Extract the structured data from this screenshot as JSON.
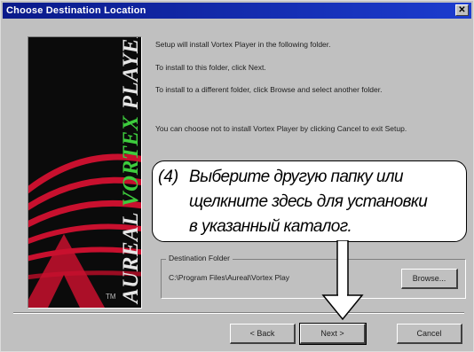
{
  "window": {
    "title": "Choose Destination Location",
    "close_glyph": "✕"
  },
  "banner": {
    "brand_word1": "AUREAL ",
    "brand_word2": "VORTEX",
    "brand_word3": " PLAYER",
    "tm": "TM",
    "colors": {
      "accent_green": "#3dcc3d",
      "accent_red": "#c8102e"
    }
  },
  "content": {
    "paragraphs": [
      "Setup will install Vortex Player in the following folder.",
      "To install to this folder, click Next.",
      "To install to a different folder, click Browse and select another folder.",
      "You can choose not to install Vortex Player by clicking Cancel to exit Setup."
    ]
  },
  "callout": {
    "number": "(4)",
    "lines": [
      "Выберите другую папку или",
      "щелкните здесь для установки",
      "в указанный каталог."
    ]
  },
  "destination": {
    "label": "Destination Folder",
    "path": "C:\\Program Files\\Aureal\\Vortex Play",
    "browse_button": "Browse..."
  },
  "buttons": {
    "back": "< Back",
    "next": "Next >",
    "cancel": "Cancel"
  }
}
